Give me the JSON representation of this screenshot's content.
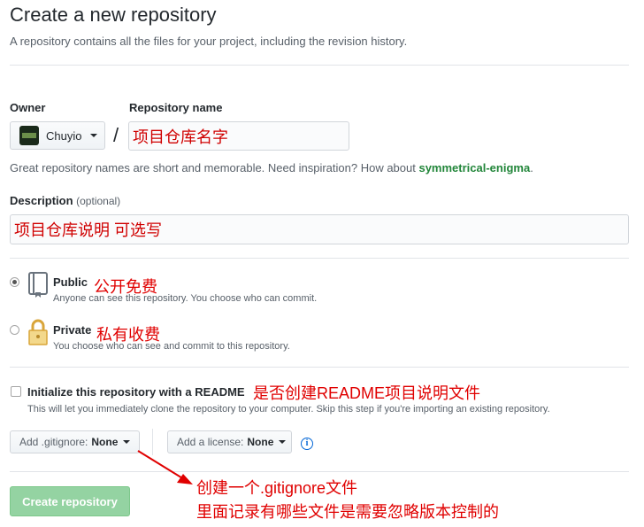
{
  "header": {
    "title": "Create a new repository",
    "subtitle": "A repository contains all the files for your project, including the revision history."
  },
  "owner": {
    "label": "Owner",
    "value": "Chuyio"
  },
  "repo_name": {
    "label": "Repository name",
    "value": "项目仓库名字"
  },
  "name_hint": {
    "prefix": "Great repository names are short and memorable. Need inspiration? How about ",
    "suggestion": "symmetrical-enigma",
    "suffix": "."
  },
  "description": {
    "label": "Description",
    "optional": "(optional)",
    "value": "项目仓库说明 可选写"
  },
  "visibility": {
    "public": {
      "label": "Public",
      "desc": "Anyone can see this repository. You choose who can commit.",
      "annotation": "公开免费",
      "selected": true
    },
    "private": {
      "label": "Private",
      "desc": "You choose who can see and commit to this repository.",
      "annotation": "私有收费",
      "selected": false
    }
  },
  "readme": {
    "label": "Initialize this repository with a README",
    "annotation": "是否创建README项目说明文件",
    "desc": "This will let you immediately clone the repository to your computer. Skip this step if you're importing an existing repository.",
    "checked": false
  },
  "gitignore": {
    "label": "Add .gitignore:",
    "value": "None"
  },
  "license": {
    "label": "Add a license:",
    "value": "None"
  },
  "info_icon": "info-icon",
  "submit": {
    "label": "Create repository"
  },
  "annotation_gitignore": {
    "line1": "创建一个.gitignore文件",
    "line2": "里面记录有哪些文件是需要忽略版本控制的"
  },
  "colors": {
    "annotation": "#e00000",
    "suggestion": "#22863a",
    "submit_bg": "#94d3a2",
    "info": "#0366d6"
  }
}
